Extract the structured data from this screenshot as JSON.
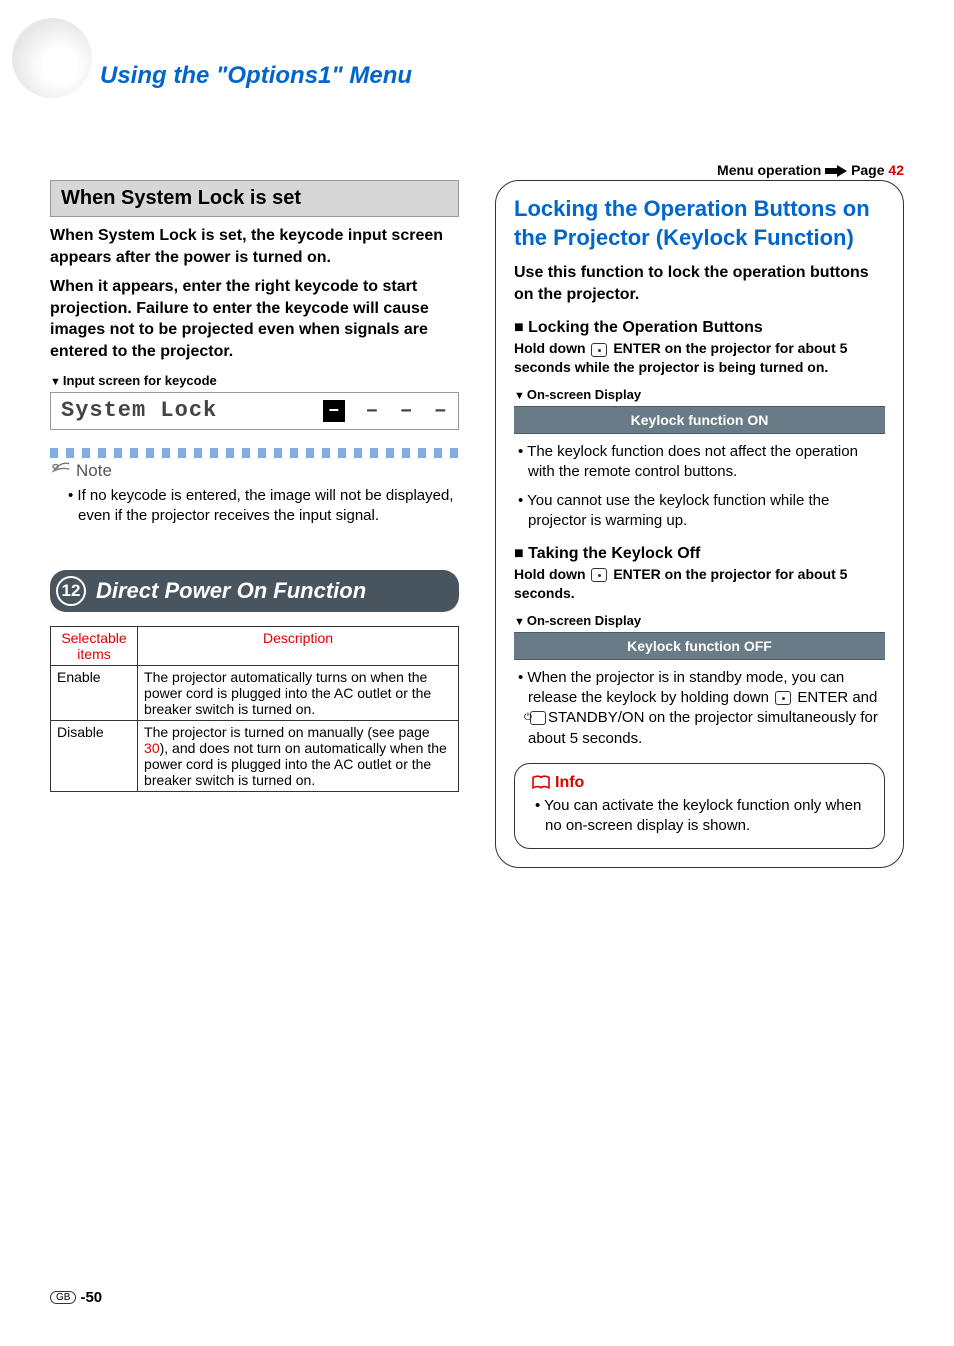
{
  "chapter_title": "Using the \"Options1\" Menu",
  "menu_operation": {
    "label": "Menu operation",
    "page_word": "Page",
    "page_num": "42"
  },
  "left": {
    "grey_bar": "When System Lock is set",
    "para1": "When System Lock is set, the keycode input screen appears after the power is turned on.",
    "para2": "When it appears, enter the right keycode to start projection. Failure to enter the keycode will cause images not to be projected even when signals are entered to the projector.",
    "input_label": "Input screen for keycode",
    "syslock_text": "System Lock",
    "dash": "–",
    "note_word": "Note",
    "note_text": "If no keycode is entered, the image will not be displayed, even if the projector receives the input signal.",
    "section_num": "12",
    "section_title": "Direct Power On Function",
    "table": {
      "h1": "Selectable items",
      "h2": "Description",
      "r1c1": "Enable",
      "r1c2": "The projector automatically turns on when the power cord is plugged into the AC outlet or the breaker switch is turned on.",
      "r2c1": "Disable",
      "r2c2a": "The projector is turned on manually (see page ",
      "r2c2_pg": "30",
      "r2c2b": "), and does not turn on automatically when the power cord is plugged into the AC outlet or the breaker switch is turned on."
    }
  },
  "right": {
    "heading": "Locking the Operation Buttons on the Projector (Keylock Function)",
    "sub": "Use this function to lock the operation buttons on the projector.",
    "lock_title": "Locking the Operation Buttons",
    "hold1a": "Hold down ",
    "hold1b": " ENTER on the projector for about 5 seconds while the projector is being turned on.",
    "osd_label": "On-screen Display",
    "bar_on": "Keylock function ON",
    "bul1": "The keylock function does not affect the operation with the remote control buttons.",
    "bul2": "You cannot use the keylock function while the projector is warming up.",
    "off_title": "Taking the Keylock Off",
    "hold2a": "Hold down ",
    "hold2b": " ENTER on the projector for about 5 seconds.",
    "bar_off": "Keylock function OFF",
    "bul3a": "When the projector is in standby mode, you can release the keylock by holding down ",
    "bul3b": " ENTER and ",
    "bul3c": "STANDBY/ON on the projector simultaneously for about 5 seconds.",
    "info_word": "Info",
    "info_text": "You can activate the keylock function only when no on-screen display is shown."
  },
  "footer": {
    "region": "GB",
    "page": "-50"
  }
}
